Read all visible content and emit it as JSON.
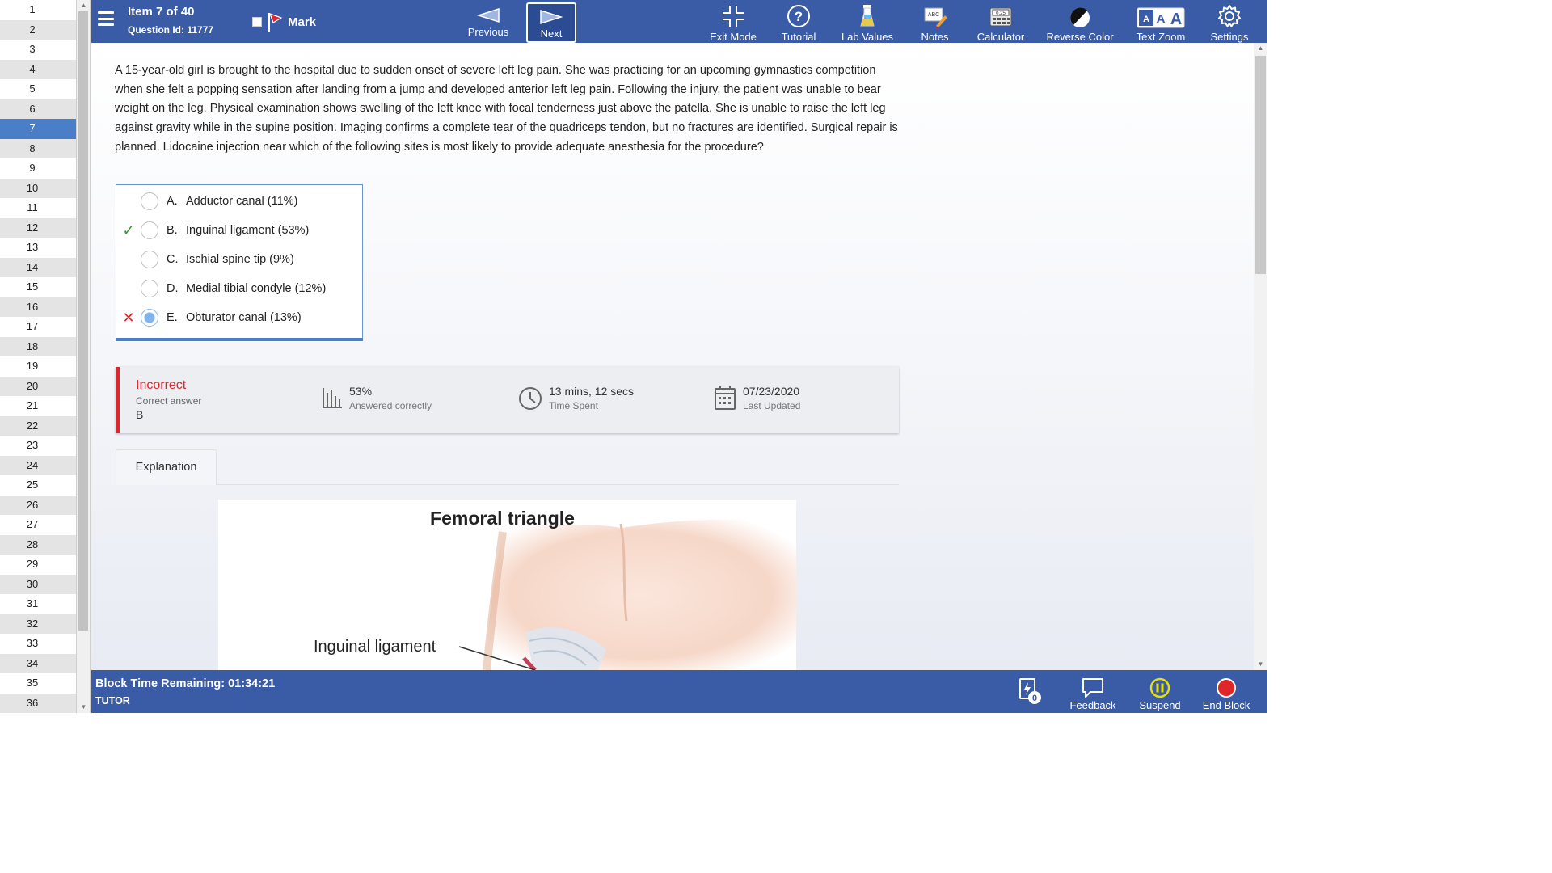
{
  "question_list": {
    "numbers": [
      "1",
      "2",
      "3",
      "4",
      "5",
      "6",
      "7",
      "8",
      "9",
      "10",
      "11",
      "12",
      "13",
      "14",
      "15",
      "16",
      "17",
      "18",
      "19",
      "20",
      "21",
      "22",
      "23",
      "24",
      "25",
      "26",
      "27",
      "28",
      "29",
      "30",
      "31",
      "32",
      "33",
      "34",
      "35",
      "36"
    ],
    "current": "7"
  },
  "header": {
    "item_title": "Item 7 of 40",
    "question_id": "Question Id: 11777",
    "mark_label": "Mark",
    "previous_label": "Previous",
    "next_label": "Next",
    "tools": {
      "exit_mode": "Exit Mode",
      "tutorial": "Tutorial",
      "lab_values": "Lab Values",
      "notes": "Notes",
      "calculator": "Calculator",
      "calculator_display": "0.25",
      "notes_icon_text": "ABC",
      "reverse_color": "Reverse Color",
      "text_zoom": "Text Zoom",
      "settings": "Settings"
    }
  },
  "question": {
    "stem": "A 15-year-old girl is brought to the hospital due to sudden onset of severe left leg pain.  She was practicing for an upcoming gymnastics competition when she felt a popping sensation after landing from a jump and developed anterior left leg pain.  Following the injury, the patient was unable to bear weight on the leg.  Physical examination shows swelling of the left knee with focal tenderness just above the patella.  She is unable to raise the left leg against gravity while in the supine position.  Imaging confirms a complete tear of the quadriceps tendon, but no fractures are identified.  Surgical repair is planned.  Lidocaine injection near which of the following sites is most likely to provide adequate anesthesia for the procedure?",
    "options": [
      {
        "letter": "A.",
        "text": "Adductor canal (11%)",
        "status": "none",
        "selected": false
      },
      {
        "letter": "B.",
        "text": "Inguinal ligament (53%)",
        "status": "correct",
        "selected": false
      },
      {
        "letter": "C.",
        "text": "Ischial spine tip (9%)",
        "status": "none",
        "selected": false
      },
      {
        "letter": "D.",
        "text": "Medial tibial condyle (12%)",
        "status": "none",
        "selected": false
      },
      {
        "letter": "E.",
        "text": "Obturator canal (13%)",
        "status": "incorrect",
        "selected": true
      }
    ]
  },
  "result": {
    "status": "Incorrect",
    "correct_answer_label": "Correct answer",
    "correct_answer": "B",
    "percent_value": "53%",
    "percent_label": "Answered correctly",
    "time_value": "13 mins, 12 secs",
    "time_label": "Time Spent",
    "date_value": "07/23/2020",
    "date_label": "Last Updated"
  },
  "explanation": {
    "tab_label": "Explanation",
    "figure_title": "Femoral triangle",
    "figure_label": "Inguinal ligament"
  },
  "footer": {
    "timer": "Block Time Remaining: 01:34:21",
    "mode": "TUTOR",
    "flash_count": "0",
    "feedback": "Feedback",
    "suspend": "Suspend",
    "end_block": "End Block"
  },
  "colors": {
    "bar": "#3a5ba6",
    "accent": "#4a7ec6",
    "incorrect": "#e0252b",
    "correct": "#2e9c3b",
    "suspend": "#e8e000"
  }
}
